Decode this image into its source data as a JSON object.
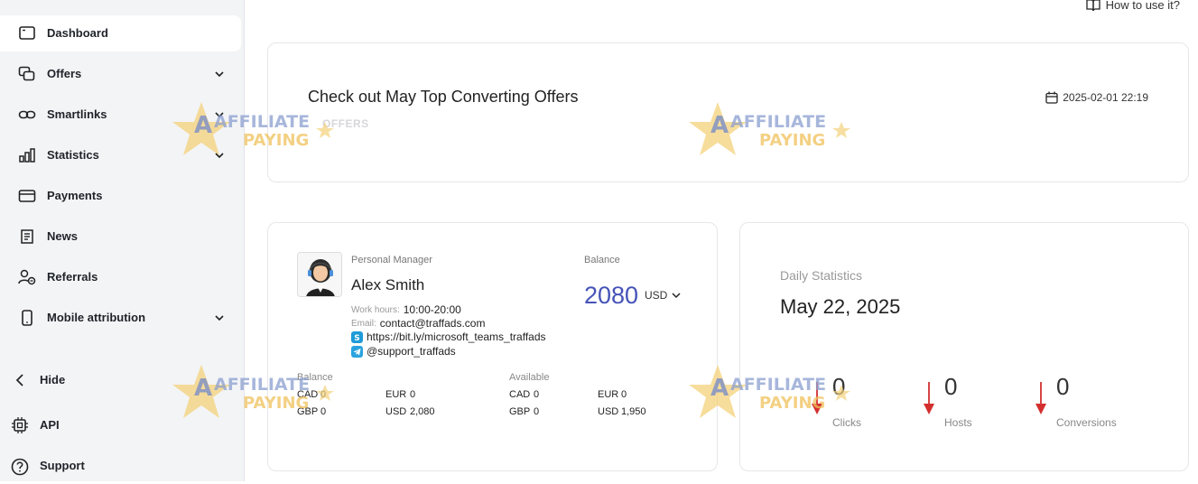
{
  "sidebar": {
    "items": [
      {
        "label": "Dashboard"
      },
      {
        "label": "Offers"
      },
      {
        "label": "Smartlinks"
      },
      {
        "label": "Statistics"
      },
      {
        "label": "Payments"
      },
      {
        "label": "News"
      },
      {
        "label": "Referrals"
      },
      {
        "label": "Mobile attribution"
      }
    ],
    "bottom": [
      {
        "label": "Hide"
      },
      {
        "label": "API"
      },
      {
        "label": "Support"
      }
    ]
  },
  "header": {
    "howto": "How to use it?"
  },
  "banner": {
    "title": "Check out May Top Converting Offers",
    "subtitle": "OFFERS",
    "date": "2025-02-01 22:19"
  },
  "manager": {
    "label": "Personal Manager",
    "name": "Alex Smith",
    "hours_key": "Work hours:",
    "hours": "10:00-20:00",
    "email_key": "Email:",
    "email": "contact@traffads.com",
    "skype": "https://bit.ly/microsoft_teams_traffads",
    "telegram": "@support_traffads"
  },
  "balance": {
    "label": "Balance",
    "value": "2080",
    "currency": "USD",
    "table": {
      "balance_header": "Balance",
      "available_header": "Available",
      "balance_rows": [
        [
          "CAD",
          "0",
          "EUR",
          "0"
        ],
        [
          "GBP",
          "0",
          "USD",
          "2,080"
        ]
      ],
      "available_rows": [
        [
          "CAD",
          "0",
          "EUR",
          "0"
        ],
        [
          "GBP",
          "0",
          "USD",
          "1,950"
        ]
      ]
    }
  },
  "daily": {
    "label": "Daily Statistics",
    "date": "May 22, 2025",
    "stats": [
      {
        "value": "0",
        "label": "Clicks"
      },
      {
        "value": "0",
        "label": "Hosts"
      },
      {
        "value": "0",
        "label": "Conversions"
      }
    ]
  },
  "watermark": {
    "line1": "AFFILIATE",
    "line2": "PAYING"
  },
  "colors": {
    "accent": "#4553b8",
    "down_arrow": "#d32f2f",
    "sidebar_bg": "#f3f4f6"
  }
}
